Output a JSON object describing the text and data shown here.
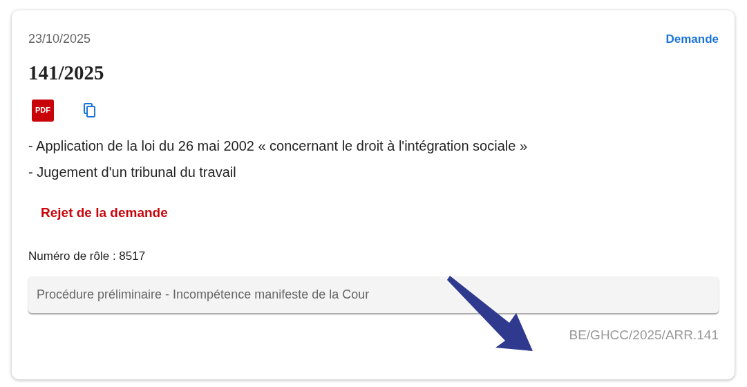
{
  "date": "23/10/2025",
  "type_link": "Demande",
  "title": "141/2025",
  "pdf_label": "PDF",
  "subjects": [
    "- Application de la loi du 26 mai 2002 « concernant le droit à l'intégration sociale »",
    "- Jugement d'un tribunal du travail"
  ],
  "decision": "Rejet de la demande",
  "role_number": "Numéro de rôle : 8517",
  "procedure": "Procédure préliminaire - Incompétence manifeste de la Cour",
  "ecli": "BE/GHCC/2025/ARR.141"
}
